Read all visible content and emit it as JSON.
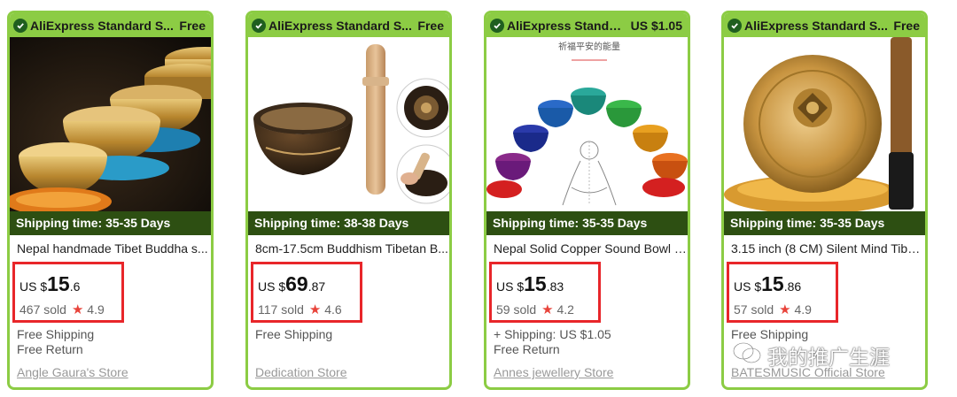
{
  "cards": [
    {
      "header": "AliExpress Standard S...",
      "fee": "Free",
      "shipping": "Shipping time: 35-35 Days",
      "title": "Nepal handmade Tibet Buddha s...",
      "currency": "US $",
      "price_int": "15",
      "price_dec": ".6",
      "sold": "467 sold",
      "rating": "4.9",
      "info1": "Free Shipping",
      "info2": "Free Return",
      "store": "Angle Gaura's Store"
    },
    {
      "header": "AliExpress Standard S...",
      "fee": "Free",
      "shipping": "Shipping time: 38-38 Days",
      "title": "8cm-17.5cm Buddhism Tibetan B...",
      "currency": "US $",
      "price_int": "69",
      "price_dec": ".87",
      "sold": "117 sold",
      "rating": "4.6",
      "info1": "Free Shipping",
      "info2": "",
      "store": "Dedication Store"
    },
    {
      "header": "AliExpress Standard...",
      "fee": "US $1.05",
      "shipping": "Shipping time: 35-35 Days",
      "title": "Nepal Solid Copper Sound Bowl S...",
      "currency": "US $",
      "price_int": "15",
      "price_dec": ".83",
      "sold": "59 sold",
      "rating": "4.2",
      "info1": "+ Shipping: US $1.05",
      "info2": "Free Return",
      "store": "Annes jewellery Store"
    },
    {
      "header": "AliExpress Standard S...",
      "fee": "Free",
      "shipping": "Shipping time: 35-35 Days",
      "title": "3.15 inch (8 CM) Silent Mind Tibet...",
      "currency": "US $",
      "price_int": "15",
      "price_dec": ".86",
      "sold": "57 sold",
      "rating": "4.9",
      "info1": "Free Shipping",
      "info2": "",
      "store": "BATESMUSIC Official Store"
    }
  ],
  "image_texts": {
    "card3_banner": "祈福平安的能量"
  },
  "watermark": "我的推广生涯",
  "colors": {
    "card_border": "#8ccc44",
    "shipping_bar": "#2d4f12",
    "highlight_box": "#e8262a",
    "star": "#e8433a"
  }
}
